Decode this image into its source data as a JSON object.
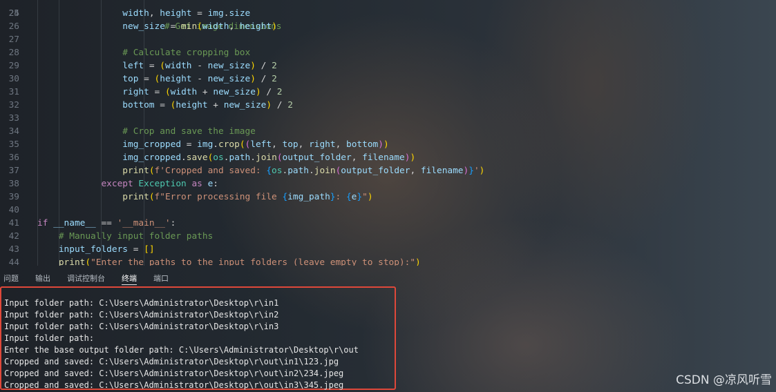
{
  "editor": {
    "lines": [
      {
        "n": "25",
        "indent": "                ",
        "tokens": [
          [
            "width",
            "var"
          ],
          [
            ", ",
            ""
          ],
          [
            "height",
            "var"
          ],
          [
            " = ",
            ""
          ],
          [
            "img",
            "var"
          ],
          [
            ".",
            ""
          ],
          [
            "size",
            "var"
          ]
        ]
      },
      {
        "n": "26",
        "indent": "                ",
        "tokens": [
          [
            "new_size",
            "var"
          ],
          [
            " = ",
            ""
          ],
          [
            "min",
            "fn"
          ],
          [
            "(",
            "p1"
          ],
          [
            "width",
            "var"
          ],
          [
            ", ",
            ""
          ],
          [
            "height",
            "var"
          ],
          [
            ")",
            "p1"
          ]
        ]
      },
      {
        "n": "27",
        "indent": "",
        "tokens": []
      },
      {
        "n": "28",
        "indent": "                ",
        "tokens": [
          [
            "# Calculate cropping box",
            "com"
          ]
        ]
      },
      {
        "n": "29",
        "indent": "                ",
        "tokens": [
          [
            "left",
            "var"
          ],
          [
            " = ",
            ""
          ],
          [
            "(",
            "p1"
          ],
          [
            "width",
            "var"
          ],
          [
            " - ",
            ""
          ],
          [
            "new_size",
            "var"
          ],
          [
            ")",
            "p1"
          ],
          [
            " / ",
            ""
          ],
          [
            "2",
            "num"
          ]
        ]
      },
      {
        "n": "30",
        "indent": "                ",
        "tokens": [
          [
            "top",
            "var"
          ],
          [
            " = ",
            ""
          ],
          [
            "(",
            "p1"
          ],
          [
            "height",
            "var"
          ],
          [
            " - ",
            ""
          ],
          [
            "new_size",
            "var"
          ],
          [
            ")",
            "p1"
          ],
          [
            " / ",
            ""
          ],
          [
            "2",
            "num"
          ]
        ]
      },
      {
        "n": "31",
        "indent": "                ",
        "tokens": [
          [
            "right",
            "var"
          ],
          [
            " = ",
            ""
          ],
          [
            "(",
            "p1"
          ],
          [
            "width",
            "var"
          ],
          [
            " + ",
            ""
          ],
          [
            "new_size",
            "var"
          ],
          [
            ")",
            "p1"
          ],
          [
            " / ",
            ""
          ],
          [
            "2",
            "num"
          ]
        ]
      },
      {
        "n": "32",
        "indent": "                ",
        "tokens": [
          [
            "bottom",
            "var"
          ],
          [
            " = ",
            ""
          ],
          [
            "(",
            "p1"
          ],
          [
            "height",
            "var"
          ],
          [
            " + ",
            ""
          ],
          [
            "new_size",
            "var"
          ],
          [
            ")",
            "p1"
          ],
          [
            " / ",
            ""
          ],
          [
            "2",
            "num"
          ]
        ]
      },
      {
        "n": "33",
        "indent": "",
        "tokens": []
      },
      {
        "n": "34",
        "indent": "                ",
        "tokens": [
          [
            "# Crop and save the image",
            "com"
          ]
        ]
      },
      {
        "n": "35",
        "indent": "                ",
        "tokens": [
          [
            "img_cropped",
            "var"
          ],
          [
            " = ",
            ""
          ],
          [
            "img",
            "var"
          ],
          [
            ".",
            ""
          ],
          [
            "crop",
            "fn"
          ],
          [
            "(",
            "p1"
          ],
          [
            "(",
            "p2"
          ],
          [
            "left",
            "var"
          ],
          [
            ", ",
            ""
          ],
          [
            "top",
            "var"
          ],
          [
            ", ",
            ""
          ],
          [
            "right",
            "var"
          ],
          [
            ", ",
            ""
          ],
          [
            "bottom",
            "var"
          ],
          [
            ")",
            "p2"
          ],
          [
            ")",
            "p1"
          ]
        ]
      },
      {
        "n": "36",
        "indent": "                ",
        "tokens": [
          [
            "img_cropped",
            "var"
          ],
          [
            ".",
            ""
          ],
          [
            "save",
            "fn"
          ],
          [
            "(",
            "p1"
          ],
          [
            "os",
            "cls"
          ],
          [
            ".",
            ""
          ],
          [
            "path",
            "var"
          ],
          [
            ".",
            ""
          ],
          [
            "join",
            "fn"
          ],
          [
            "(",
            "p2"
          ],
          [
            "output_folder",
            "var"
          ],
          [
            ", ",
            ""
          ],
          [
            "filename",
            "var"
          ],
          [
            ")",
            "p2"
          ],
          [
            ")",
            "p1"
          ]
        ]
      },
      {
        "n": "37",
        "indent": "                ",
        "tokens": [
          [
            "print",
            "fn"
          ],
          [
            "(",
            "p1"
          ],
          [
            "f'Cropped and saved: ",
            "str"
          ],
          [
            "{",
            "p3"
          ],
          [
            "os",
            "cls"
          ],
          [
            ".",
            ""
          ],
          [
            "path",
            "var"
          ],
          [
            ".",
            ""
          ],
          [
            "join",
            "fn"
          ],
          [
            "(",
            "p2"
          ],
          [
            "output_folder",
            "var"
          ],
          [
            ", ",
            ""
          ],
          [
            "filename",
            "var"
          ],
          [
            ")",
            "p2"
          ],
          [
            "}",
            "p3"
          ],
          [
            "'",
            "str"
          ],
          [
            ")",
            "p1"
          ]
        ]
      },
      {
        "n": "38",
        "indent": "            ",
        "tokens": [
          [
            "except ",
            "kw"
          ],
          [
            "Exception",
            "cls"
          ],
          [
            " as ",
            "kw"
          ],
          [
            "e",
            "var"
          ],
          [
            ":",
            ""
          ]
        ]
      },
      {
        "n": "39",
        "indent": "                ",
        "tokens": [
          [
            "print",
            "fn"
          ],
          [
            "(",
            "p1"
          ],
          [
            "f\"Error processing file ",
            "str"
          ],
          [
            "{",
            "p3"
          ],
          [
            "img_path",
            "var"
          ],
          [
            "}",
            "p3"
          ],
          [
            ": ",
            "str"
          ],
          [
            "{",
            "p3"
          ],
          [
            "e",
            "var"
          ],
          [
            "}",
            "p3"
          ],
          [
            "\"",
            "str"
          ],
          [
            ")",
            "p1"
          ]
        ]
      },
      {
        "n": "40",
        "indent": "",
        "tokens": []
      },
      {
        "n": "41",
        "indent": "",
        "tokens": [
          [
            "if ",
            "kw"
          ],
          [
            "__name__",
            "var"
          ],
          [
            " == ",
            ""
          ],
          [
            "'__main__'",
            "str"
          ],
          [
            ":",
            ""
          ]
        ]
      },
      {
        "n": "42",
        "indent": "    ",
        "tokens": [
          [
            "# Manually input folder paths",
            "com"
          ]
        ]
      },
      {
        "n": "43",
        "indent": "    ",
        "tokens": [
          [
            "input_folders",
            "var"
          ],
          [
            " = ",
            ""
          ],
          [
            "[]",
            "p1"
          ]
        ]
      },
      {
        "n": "44",
        "indent": "    ",
        "tokens": [
          [
            "print",
            "fn"
          ],
          [
            "(",
            "p1"
          ],
          [
            "\"Enter the paths to the input folders (leave empty to stop):\"",
            "str"
          ],
          [
            ")",
            "p1"
          ]
        ]
      }
    ],
    "partial_top_line": {
      "n": "24",
      "text": "# Get image dimensions"
    }
  },
  "panel": {
    "tabs": [
      "问题",
      "输出",
      "调试控制台",
      "终端",
      "端口"
    ],
    "active_tab": "终端"
  },
  "terminal": {
    "lines": [
      "Input folder path: C:\\Users\\Administrator\\Desktop\\r\\in1",
      "Input folder path: C:\\Users\\Administrator\\Desktop\\r\\in2",
      "Input folder path: C:\\Users\\Administrator\\Desktop\\r\\in3",
      "Input folder path: ",
      "Enter the base output folder path: C:\\Users\\Administrator\\Desktop\\r\\out",
      "Cropped and saved: C:\\Users\\Administrator\\Desktop\\r\\out\\in1\\123.jpg",
      "Cropped and saved: C:\\Users\\Administrator\\Desktop\\r\\out\\in2\\234.jpeg",
      "Cropped and saved: C:\\Users\\Administrator\\Desktop\\r\\out\\in3\\345.jpeg"
    ],
    "highlight_color": "#e0483a"
  },
  "watermark": "CSDN @凉风听雪"
}
